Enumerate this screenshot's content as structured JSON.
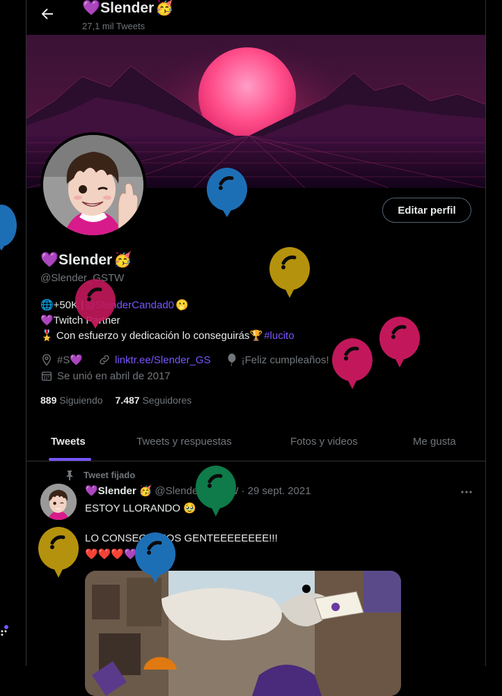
{
  "header": {
    "back_label": "Back",
    "name": "💜Slender",
    "name_emoji": "🥳",
    "tweet_count": "27,1 mil Tweets"
  },
  "profile": {
    "edit_button": "Editar perfil",
    "name": "💜Slender",
    "name_emoji": "🥳",
    "handle": "@Slender_GSTW",
    "bio": {
      "line1_prefix": "🌐+50K | ",
      "line1_mention": "@SlenderCandad0",
      "line1_suffix": " 🫢",
      "line2": "💜Twitch Partner",
      "line3_prefix": "🎖️ Con esfuerzo y dedicación lo conseguirás🏆",
      "line3_hashtag": "#lucito"
    },
    "location": "#S💜",
    "website": "linktr.ee/Slender_GS",
    "birthday": "¡Feliz cumpleaños!",
    "joined": "Se unió en abril de 2017",
    "following_count": "889",
    "following_label": "Siguiendo",
    "followers_count": "7.487",
    "followers_label": "Seguidores"
  },
  "tabs": [
    {
      "label": "Tweets"
    },
    {
      "label": "Tweets y respuestas"
    },
    {
      "label": "Fotos y videos"
    },
    {
      "label": "Me gusta"
    }
  ],
  "tweet": {
    "pinned_label": "Tweet fijado",
    "author": "💜Slender",
    "author_emoji": "🥳",
    "handle": "@Slender_GSTW",
    "separator": "·",
    "date": "29 sept. 2021",
    "text_line1": "ESTOY LLORANDO 🥹",
    "text_line2": "LO CONSEGUIMOS GENTEEEEEEEE!!!",
    "text_line3": "❤️❤️❤️💜"
  },
  "colors": {
    "accent": "#7856ff",
    "background": "#000000",
    "secondary_text": "#71767b",
    "border": "#2f3336",
    "balloon_blue": "#1d6fb5",
    "balloon_yellow": "#b5920d",
    "balloon_magenta": "#c2185b",
    "balloon_green": "#0f7a4a",
    "balloon_orange": "#e07a10"
  },
  "icons": {
    "back": "arrow-left-icon",
    "location": "location-pin-icon",
    "link": "link-icon",
    "birthday": "balloon-icon",
    "calendar": "calendar-icon",
    "pin": "pin-icon",
    "more": "more-icon"
  }
}
